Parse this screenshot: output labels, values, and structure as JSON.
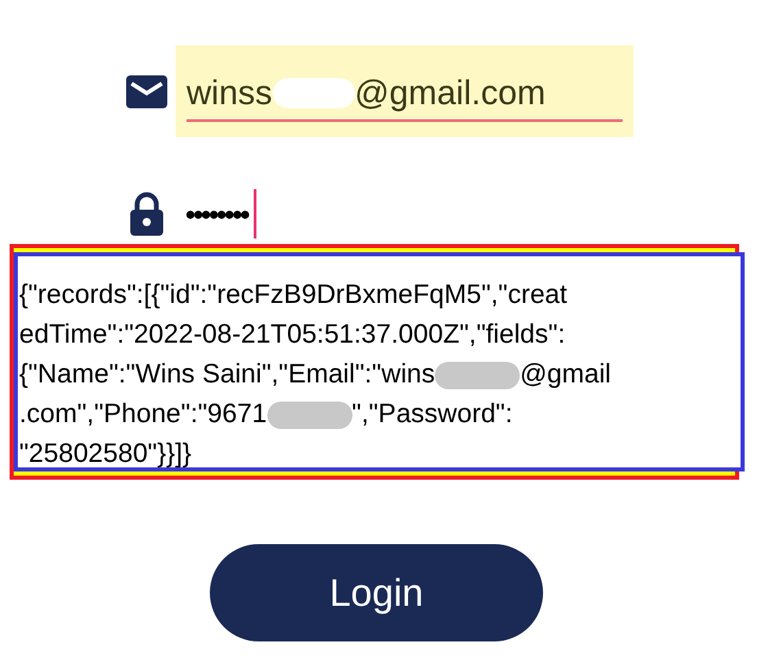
{
  "email_field": {
    "value_parts": [
      "winss",
      "@gmail.com"
    ]
  },
  "password_field": {
    "value": "••••••••"
  },
  "response": {
    "lines": [
      [
        "{\"records\":[{\"id\":\"recFzB9DrBxmeFqM5\",\"creat"
      ],
      [
        "edTime\":\"2022-08-21T05:51:37.000Z\",\"fields\":"
      ],
      [
        "{\"Name\":\"Wins Saini\",\"Email\":\"wins",
        "@gmail"
      ],
      [
        ".com\",\"Phone\":\"9671",
        "\",\"Password\":"
      ],
      [
        "\"25802580\"}}]}"
      ]
    ]
  },
  "login_button": {
    "label": "Login"
  }
}
